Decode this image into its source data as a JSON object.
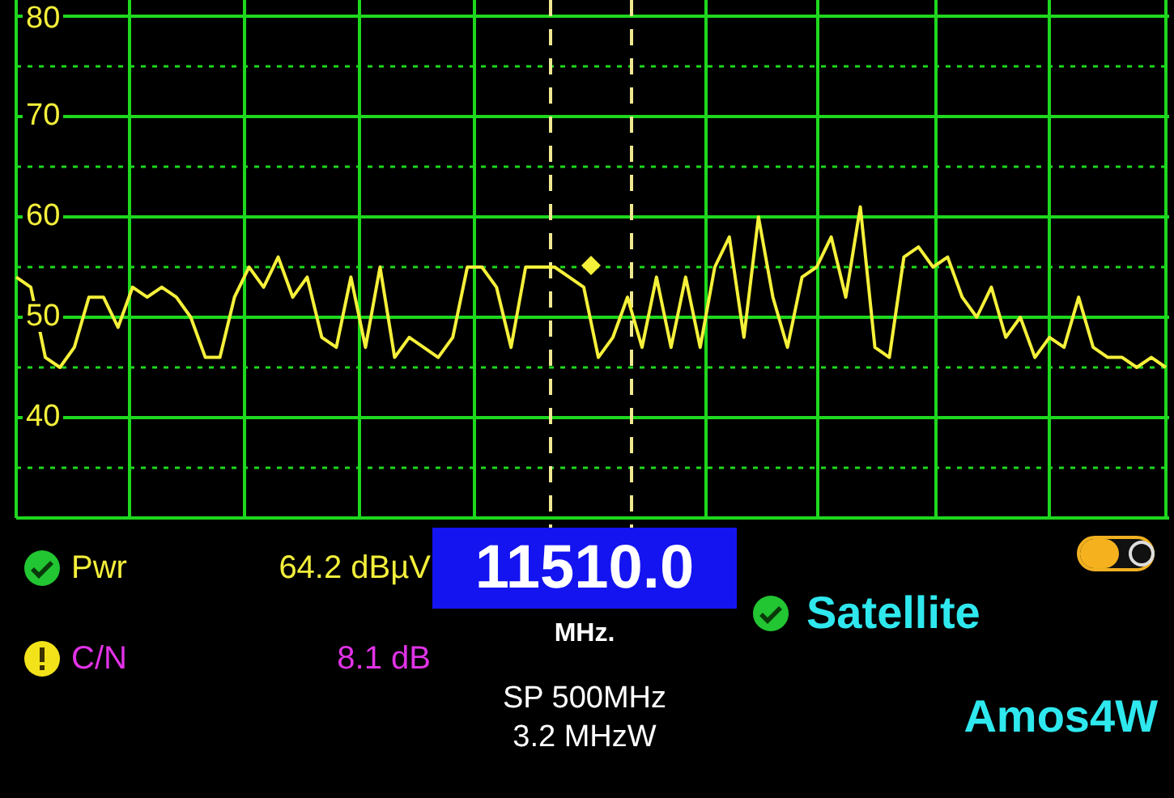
{
  "chart": {
    "chart_data": {
      "type": "line",
      "grid": true,
      "ref_lines": [
        {
          "axis": "y",
          "value": 75
        },
        {
          "axis": "y",
          "value": 65
        },
        {
          "axis": "y",
          "value": 55
        },
        {
          "axis": "y",
          "value": 45
        },
        {
          "axis": "y",
          "value": 35
        }
      ],
      "ylim": [
        30,
        80
      ],
      "yticks": [
        80,
        70,
        60,
        50,
        40
      ],
      "series": [
        {
          "color": "#f5f03a",
          "values": [
            54,
            53,
            46,
            45,
            47,
            52,
            52,
            49,
            53,
            52,
            53,
            52,
            50,
            46,
            46,
            52,
            55,
            53,
            56,
            52,
            54,
            48,
            47,
            54,
            47,
            55,
            46,
            48,
            47,
            46,
            48,
            55,
            55,
            53,
            47,
            55,
            55,
            55,
            54,
            53,
            46,
            48,
            52,
            47,
            54,
            47,
            54,
            47,
            55,
            58,
            48,
            60,
            52,
            47,
            54,
            55,
            58,
            52,
            61,
            47,
            46,
            56,
            57,
            55,
            56,
            52,
            50,
            53,
            48,
            50,
            46,
            48,
            47,
            52,
            47,
            46,
            46,
            45,
            46,
            45
          ]
        }
      ]
    }
  },
  "measurements": [
    {
      "label": "Pwr",
      "value": "64.2 dBµV",
      "warning": false
    },
    {
      "label": "C/N",
      "value": "8.1 dB",
      "warning": true
    }
  ],
  "frequency": {
    "value": "11510.0",
    "unit": "MHz.",
    "span": "SP 500MHz",
    "bandwidth": "3.2 MHzW"
  },
  "satellite": {
    "label": "Satellite",
    "locked": true,
    "name": "Amos4W"
  }
}
